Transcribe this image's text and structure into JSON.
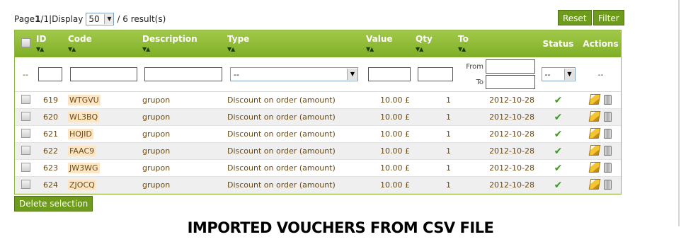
{
  "pager": {
    "page_label": "Page",
    "current": "1",
    "sep": "/",
    "total": "1",
    "pipe": "|",
    "display_label": "Display",
    "per_page": "50",
    "results": "/ 6 result(s)"
  },
  "buttons": {
    "reset": "Reset",
    "filter": "Filter",
    "delete_selection": "Delete selection"
  },
  "columns": {
    "id": "ID",
    "code": "Code",
    "description": "Description",
    "type": "Type",
    "value": "Value",
    "qty": "Qty",
    "to": "To",
    "status": "Status",
    "actions": "Actions"
  },
  "filters": {
    "dash": "--",
    "type_value": "--",
    "from_label": "From",
    "to_label": "To",
    "status_value": "--",
    "actions_dash": "--"
  },
  "icons": {
    "sort": "sort-arrows-icon",
    "check": "check-icon",
    "edit": "pencil-icon",
    "delete": "trash-icon"
  },
  "colors": {
    "header_green": "#8ab834",
    "button_green": "#6e9b1c",
    "code_bg": "#fde6c6",
    "text_brown": "#6b4a14"
  },
  "rows": [
    {
      "id": "619",
      "code": "WTGVU",
      "description": "grupon",
      "type": "Discount on order (amount)",
      "value": "10.00 £",
      "qty": "1",
      "to": "2012-10-28"
    },
    {
      "id": "620",
      "code": "WL3BQ",
      "description": "grupon",
      "type": "Discount on order (amount)",
      "value": "10.00 £",
      "qty": "1",
      "to": "2012-10-28"
    },
    {
      "id": "621",
      "code": "HOJID",
      "description": "grupon",
      "type": "Discount on order (amount)",
      "value": "10.00 £",
      "qty": "1",
      "to": "2012-10-28"
    },
    {
      "id": "622",
      "code": "FAAC9",
      "description": "grupon",
      "type": "Discount on order (amount)",
      "value": "10.00 £",
      "qty": "1",
      "to": "2012-10-28"
    },
    {
      "id": "623",
      "code": "JW3WG",
      "description": "grupon",
      "type": "Discount on order (amount)",
      "value": "10.00 £",
      "qty": "1",
      "to": "2012-10-28"
    },
    {
      "id": "624",
      "code": "ZJOCQ",
      "description": "grupon",
      "type": "Discount on order (amount)",
      "value": "10.00 £",
      "qty": "1",
      "to": "2012-10-28"
    }
  ],
  "caption": "IMPORTED VOUCHERS FROM CSV FILE"
}
